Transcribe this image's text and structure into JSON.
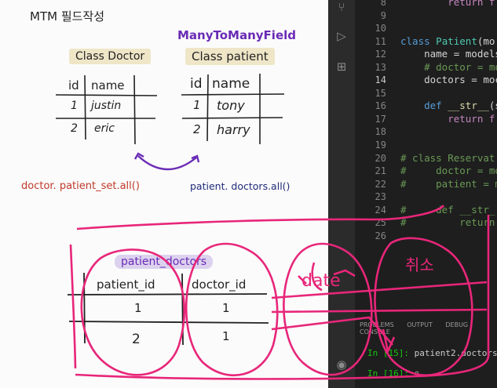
{
  "note": {
    "title": "MTM 필드작성",
    "field_label": "ManyToManyField",
    "doctor_class": "Class Doctor",
    "patient_class": "Class patient",
    "doctor_table": {
      "headers": [
        "id",
        "name"
      ],
      "rows": [
        [
          "1",
          "justin"
        ],
        [
          "2",
          "eric"
        ]
      ]
    },
    "patient_table": {
      "headers": [
        "id",
        "name"
      ],
      "rows": [
        [
          "1",
          "tony"
        ],
        [
          "2",
          "harry"
        ]
      ]
    },
    "doctor_query": "doctor. patient_set.all()",
    "patient_query": "patient. doctors.all()",
    "join_table_label": "patient_doctors",
    "join_table": {
      "headers": [
        "patient_id",
        "doctor_id"
      ],
      "rows": [
        [
          "1",
          "1"
        ],
        [
          "2",
          "1"
        ]
      ]
    },
    "annotation_date": "date",
    "annotation_korean": "취소"
  },
  "editor": {
    "lines": [
      {
        "n": "8",
        "text": "    return f"
      },
      {
        "n": "9",
        "text": ""
      },
      {
        "n": "10",
        "text": ""
      },
      {
        "n": "11",
        "text": "class Patient(mo"
      },
      {
        "n": "12",
        "text": "    name = models"
      },
      {
        "n": "13",
        "text": "    # doctor = mo"
      },
      {
        "n": "14",
        "text": "    doctors = moc"
      },
      {
        "n": "15",
        "text": ""
      },
      {
        "n": "16",
        "text": "    def __str__(s"
      },
      {
        "n": "17",
        "text": "        return f"
      },
      {
        "n": "18",
        "text": ""
      },
      {
        "n": "19",
        "text": ""
      },
      {
        "n": "20",
        "text": "# class Reservat"
      },
      {
        "n": "21",
        "text": "#     doctor = mo"
      },
      {
        "n": "22",
        "text": "#     patient = m"
      },
      {
        "n": "23",
        "text": ""
      },
      {
        "n": "24",
        "text": "#     def __str_"
      },
      {
        "n": "25",
        "text": "#         return"
      },
      {
        "n": "26",
        "text": ""
      }
    ],
    "active_line": "14",
    "panel_tabs": [
      "PROBLEMS",
      "OUTPUT",
      "DEBUG CONSOLE"
    ],
    "terminal": [
      {
        "prompt": "In [15]:",
        "text": " patient2.doctors.r"
      },
      {
        "prompt": "In [16]:",
        "text": " "
      }
    ]
  },
  "icons": [
    "source-control-icon",
    "run-debug-icon",
    "extensions-icon",
    "account-icon"
  ],
  "colors": {
    "ink_pink": "#e8267a",
    "ink_purple": "#6a2bb5",
    "ink_red": "#c0392b",
    "ink_navy": "#1f2a7a"
  }
}
